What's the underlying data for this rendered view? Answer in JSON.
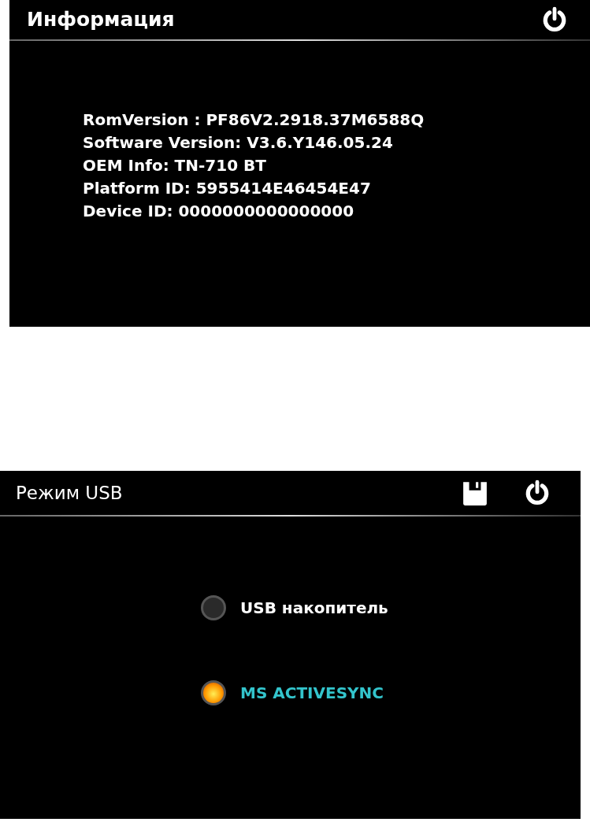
{
  "info_screen": {
    "title": "Информация",
    "lines": [
      "RomVersion : PF86V2.2918.37M6588Q",
      "Software Version: V3.6.Y146.05.24",
      "OEM Info: TN-710 BT",
      "Platform ID: 5955414E46454E47",
      "Device ID: 0000000000000000"
    ]
  },
  "usb_screen": {
    "title": "Режим USB",
    "options": [
      {
        "label": "USB накопитель",
        "selected": false
      },
      {
        "label": "MS ACTIVESYNC",
        "selected": true
      }
    ]
  }
}
